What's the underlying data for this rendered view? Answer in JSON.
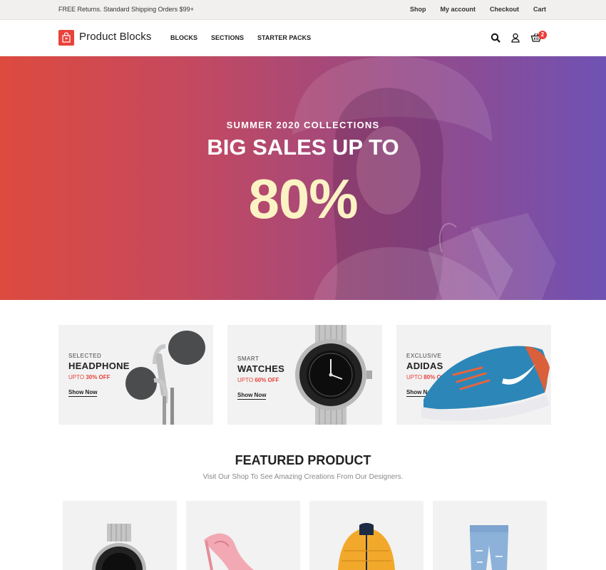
{
  "topbar": {
    "promo": "FREE Returns. Standard Shipping Orders $99+",
    "links": [
      "Shop",
      "My account",
      "Checkout",
      "Cart"
    ]
  },
  "header": {
    "brand": "Product Blocks",
    "nav": [
      "BLOCKS",
      "SECTIONS",
      "STARTER PACKS"
    ],
    "cart_count": "2",
    "icons": [
      "search-icon",
      "user-icon",
      "cart-icon"
    ]
  },
  "hero": {
    "subtitle": "SUMMER 2020 COLLECTIONS",
    "title": "BIG SALES UP TO",
    "percent": "80%"
  },
  "categories": [
    {
      "eyebrow": "SELECTED",
      "title": "HEADPHONE",
      "deal_prefix": "UPTO",
      "deal_value": "30% OFF",
      "cta": "Show Now"
    },
    {
      "eyebrow": "SMART",
      "title": "WATCHES",
      "deal_prefix": "UPTO",
      "deal_value": "60% OFF",
      "cta": "Show Now"
    },
    {
      "eyebrow": "EXCLUSIVE",
      "title": "ADIDAS",
      "deal_prefix": "UPTO",
      "deal_value": "80% OFF",
      "cta": "Show Now"
    }
  ],
  "featured": {
    "title": "FEATURED PRODUCT",
    "subtitle": "Visit Our Shop To See Amazing Creations From Our Designers.",
    "products": [
      "watch-image",
      "heels-image",
      "jacket-image",
      "jeans-image"
    ]
  },
  "colors": {
    "accent": "#e8423b",
    "hero_start": "#dd4a3f",
    "hero_end": "#6f52b4",
    "hero_percent": "#fbf3c3"
  }
}
